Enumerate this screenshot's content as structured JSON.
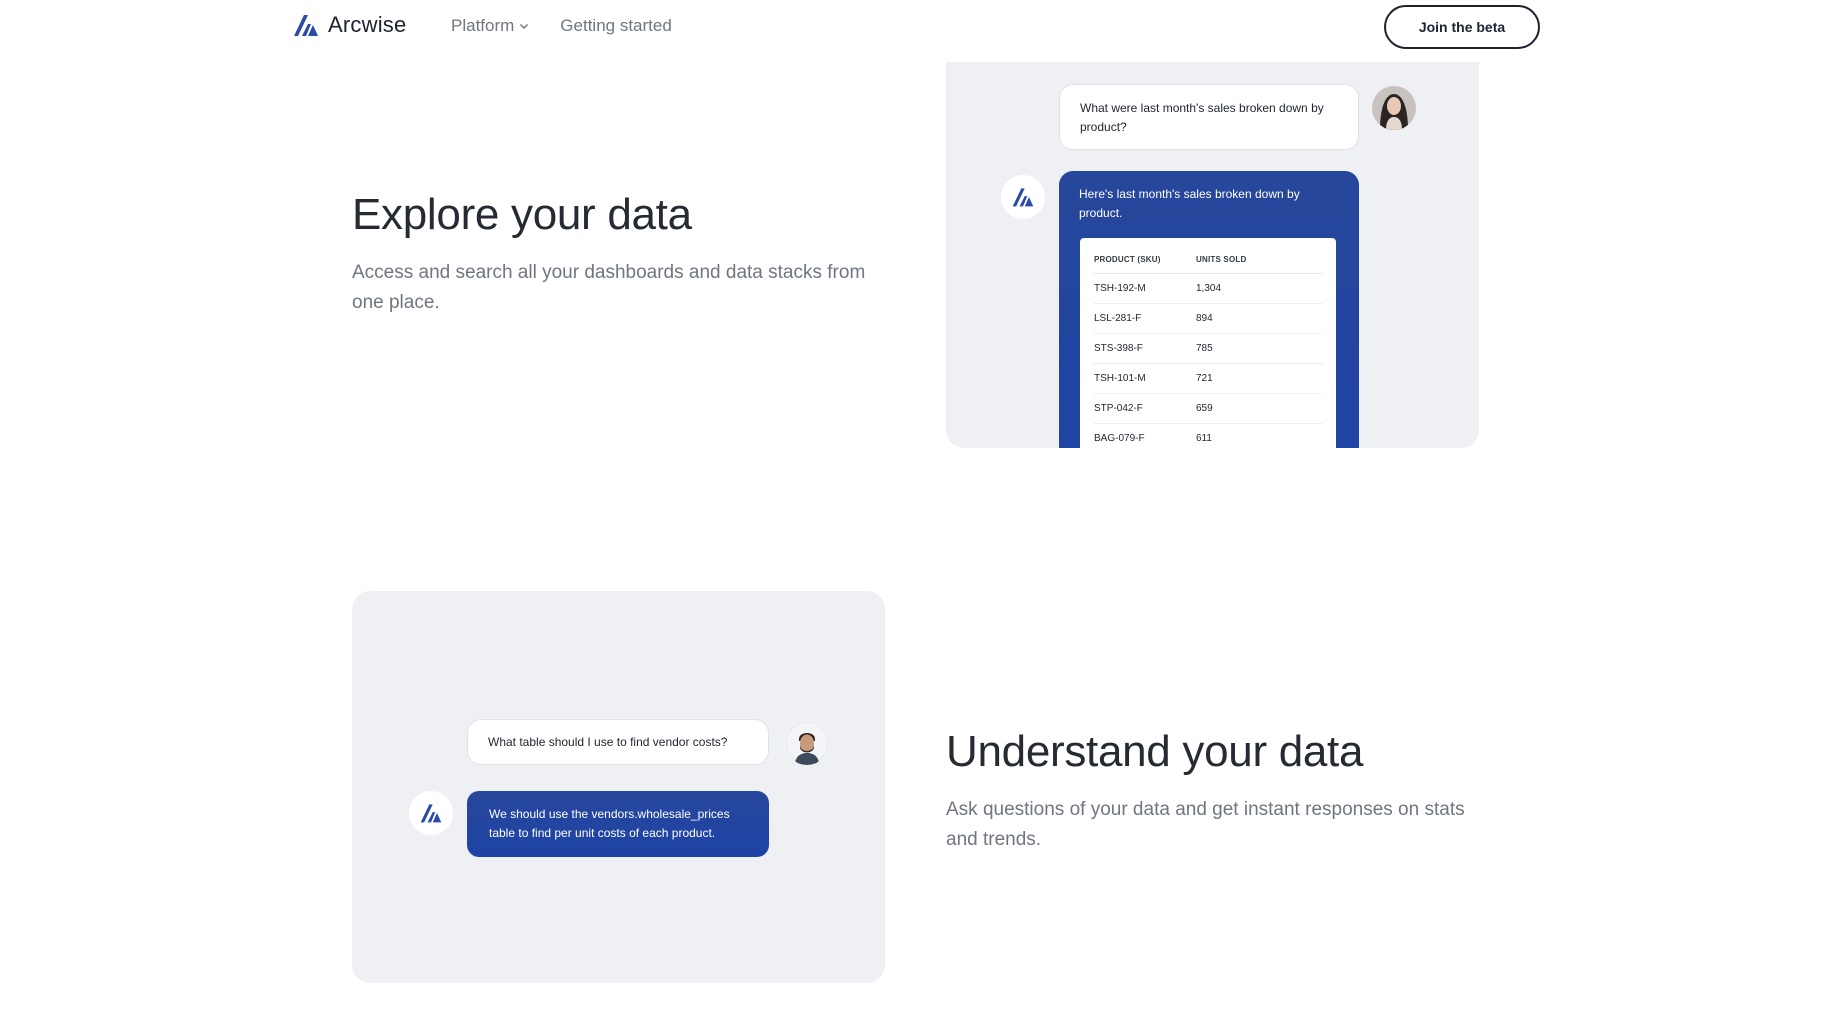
{
  "nav": {
    "brand_name": "Arcwise",
    "links": [
      {
        "label": "Platform",
        "has_dropdown": true
      },
      {
        "label": "Getting started",
        "has_dropdown": false
      }
    ],
    "cta_label": "Join the beta"
  },
  "colors": {
    "brand_blue": "#1e43a5",
    "card_bg": "#eef0f4",
    "text_dark": "#262a33",
    "text_muted": "#6f7582"
  },
  "section_explore": {
    "title": "Explore your data",
    "description": "Access and search all your dashboards and data stacks from one place.",
    "chat": {
      "question": "What were last month's sales broken down by product?",
      "answer": "Here's last month's sales broken down by product.",
      "table": {
        "headers": [
          "PRODUCT (SKU)",
          "UNITS SOLD"
        ],
        "rows": [
          [
            "TSH-192-M",
            "1,304"
          ],
          [
            "LSL-281-F",
            "894"
          ],
          [
            "STS-398-F",
            "785"
          ],
          [
            "TSH-101-M",
            "721"
          ],
          [
            "STP-042-F",
            "659"
          ],
          [
            "BAG-079-F",
            "611"
          ]
        ]
      }
    }
  },
  "section_understand": {
    "title": "Understand your data",
    "description": "Ask questions of your data and get instant responses on stats and trends.",
    "chat": {
      "question": "What table should I use to find vendor costs?",
      "answer": "We should use the vendors.wholesale_prices table to find per unit costs of each product."
    }
  }
}
